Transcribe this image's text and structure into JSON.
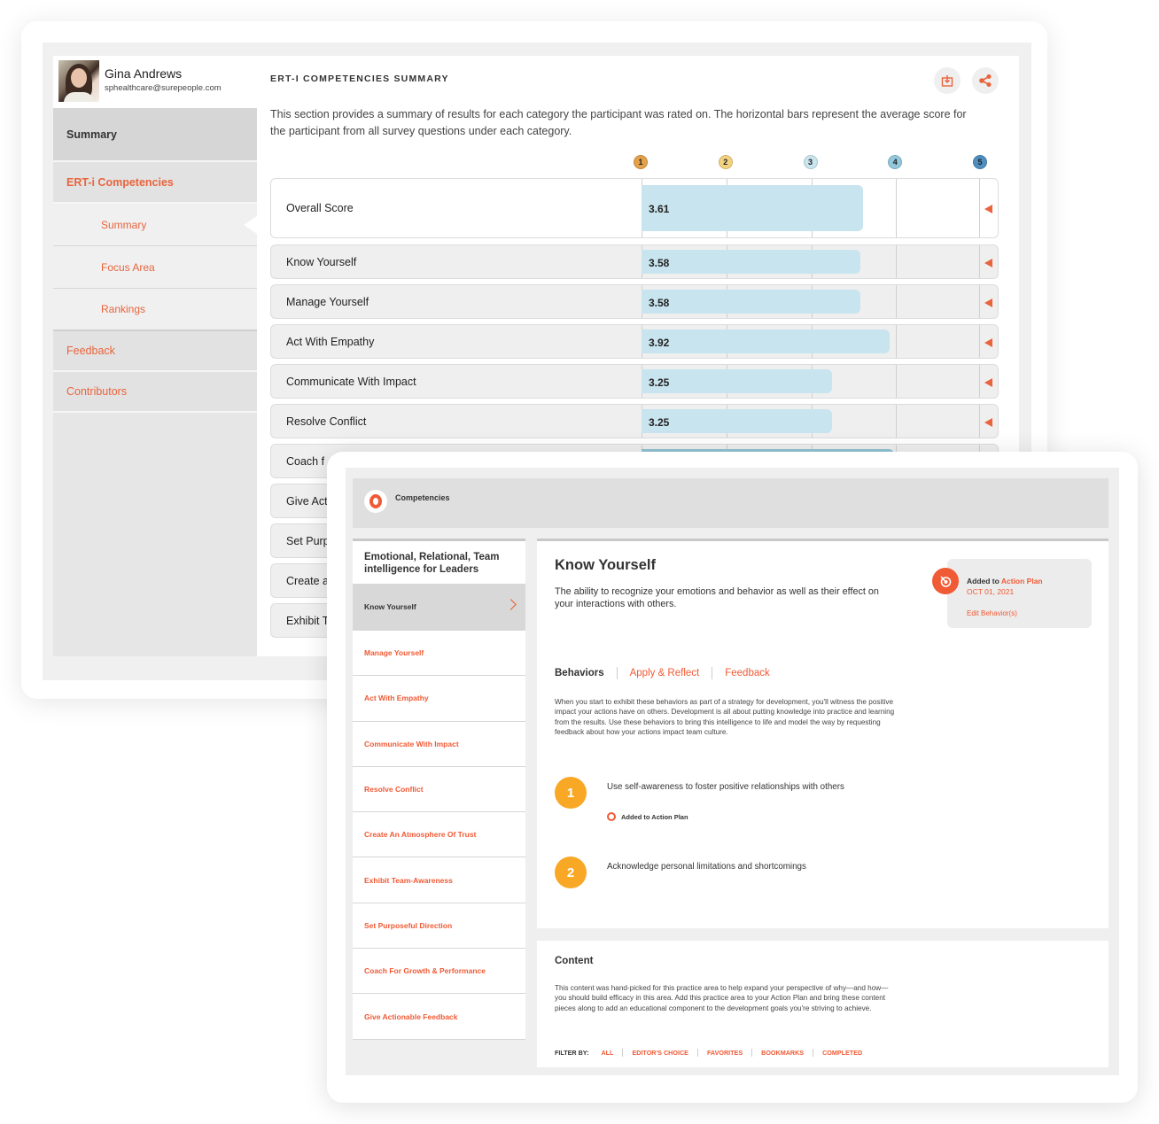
{
  "back_window": {
    "profile": {
      "name": "Gina Andrews",
      "email": "sphealthcare@surepeople.com"
    },
    "sidebar": {
      "items": [
        {
          "label": "Summary",
          "type": "section",
          "active": true
        },
        {
          "label": "ERT-i Competencies",
          "type": "section-accent"
        },
        {
          "label": "Summary",
          "type": "sub",
          "active": true
        },
        {
          "label": "Focus Area",
          "type": "sub"
        },
        {
          "label": "Rankings",
          "type": "sub"
        },
        {
          "label": "Feedback",
          "type": "plain"
        },
        {
          "label": "Contributors",
          "type": "plain"
        }
      ]
    },
    "main": {
      "title": "ERT-I COMPETENCIES SUMMARY",
      "download_icon": "download-icon",
      "share_icon": "share-icon",
      "description": "This section provides a summary of results for each category the participant was rated on. The horizontal bars represent the average score for the participant from all survey questions under each category."
    }
  },
  "chart_data": {
    "type": "bar",
    "orientation": "horizontal",
    "title": "ERT-I COMPETENCIES SUMMARY",
    "xlim": [
      1,
      5
    ],
    "scale_labels": [
      "1",
      "2",
      "3",
      "4",
      "5"
    ],
    "scale_colors": [
      "#e3a14a",
      "#f2d27f",
      "#c9e5ef",
      "#93c8dc",
      "#4e8fbf"
    ],
    "categories": [
      "Overall Score",
      "Know Yourself",
      "Manage Yourself",
      "Act With Empathy",
      "Communicate With Impact",
      "Resolve Conflict",
      "Coach for Growth & Performance",
      "Give Actionable Feedback",
      "Set Purposeful Direction",
      "Create an Atmosphere of Trust",
      "Exhibit Team-Awareness"
    ],
    "visible_labels": [
      "Overall Score",
      "Know Yourself",
      "Manage Yourself",
      "Act With Empathy",
      "Communicate With Impact",
      "Resolve Conflict",
      "Coach f",
      "Give Act",
      "Set Purp",
      "Create a",
      "Exhibit T"
    ],
    "values": [
      3.61,
      3.58,
      3.58,
      3.92,
      3.25,
      3.25,
      null,
      null,
      null,
      null,
      null
    ],
    "value_labels": [
      "3.61",
      "3.58",
      "3.58",
      "3.92",
      "3.25",
      "3.25",
      "",
      "",
      "",
      "",
      ""
    ],
    "bar_color": "#c8e4ef",
    "marker_color": "#e8643c",
    "xlabel": "",
    "ylabel": ""
  },
  "front_window": {
    "header": {
      "title": "Competencies",
      "logo_icon": "competencies-ring-icon"
    },
    "left_list": {
      "header": "Emotional, Relational, Team intelligence for Leaders",
      "items": [
        {
          "label": "Know Yourself",
          "active": true
        },
        {
          "label": "Manage Yourself"
        },
        {
          "label": "Act With Empathy"
        },
        {
          "label": "Communicate With Impact"
        },
        {
          "label": "Resolve Conflict"
        },
        {
          "label": "Create An Atmosphere Of Trust"
        },
        {
          "label": "Exhibit Team-Awareness"
        },
        {
          "label": "Set Purposeful Direction"
        },
        {
          "label": "Coach For Growth & Performance"
        },
        {
          "label": "Give Actionable Feedback"
        }
      ]
    },
    "detail": {
      "title": "Know Yourself",
      "description": "The ability to recognize your emotions and behavior as well as their effect on your interactions with others.",
      "action_plan": {
        "prefix": "Added to ",
        "link": "Action Plan",
        "date": "OCT 01, 2021",
        "edit": "Edit Behavior(s)"
      },
      "tabs": [
        {
          "label": "Behaviors",
          "active": true
        },
        {
          "label": "Apply & Reflect"
        },
        {
          "label": "Feedback"
        }
      ],
      "behaviors_description": "When you start to exhibit these behaviors as part of a strategy for development, you'll witness the positive impact your actions have on others. Development is all about putting knowledge into practice and learning from the results. Use these behaviors to bring this intelligence to life and model the way by requesting feedback about how your actions impact team culture.",
      "behaviors": [
        {
          "number": "1",
          "text": "Use self-awareness to foster positive relationships with others",
          "added_label": "Added to Action Plan"
        },
        {
          "number": "2",
          "text": "Acknowledge personal limitations and shortcomings",
          "added_label": ""
        }
      ]
    },
    "content": {
      "title": "Content",
      "description": "This content was hand-picked for this practice area to help expand your perspective of why—and how—you should build efficacy in this area. Add this practice area to your Action Plan and bring these content pieces along to add an educational component to the development goals you're striving to achieve.",
      "filter_label": "FILTER BY:",
      "filters": [
        "ALL",
        "EDITOR'S CHOICE",
        "FAVORITES",
        "BOOKMARKS",
        "COMPLETED"
      ]
    }
  }
}
